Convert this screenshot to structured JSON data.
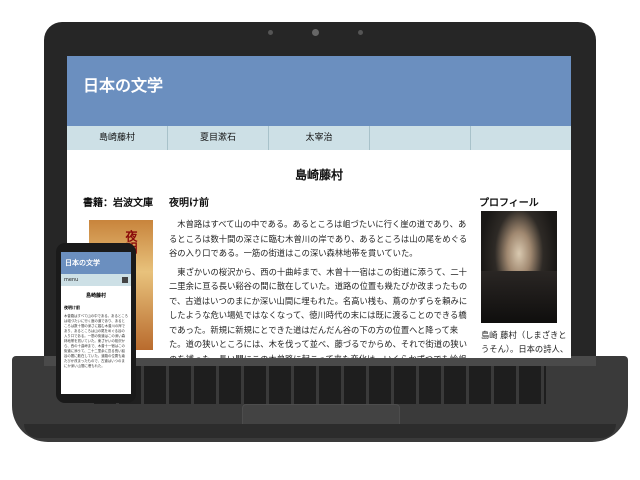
{
  "site": {
    "logo": "日本の文学"
  },
  "nav": [
    {
      "label": "島崎藤村"
    },
    {
      "label": "夏目漱石"
    },
    {
      "label": "太宰治"
    },
    {
      "label": ""
    },
    {
      "label": ""
    }
  ],
  "page_title": "島崎藤村",
  "left_column": {
    "heading": "書籍：岩波文庫",
    "book_cover_text": "夜明"
  },
  "main": {
    "heading": "夜明け前",
    "paragraphs": [
      "木曾路はすべて山の中である。あるところは岨づたいに行く崖の道であり、あるところは数十間の深さに臨む木曾川の岸であり、あるところは山の尾をめぐる谷の入り口である。一筋の街道はこの深い森林地帯を貫いていた。",
      "東ざかいの桜沢から、西の十曲峠まで、木曾十一宿はこの街道に添うて、二十二里余に亘る長い谿谷の間に散在していた。道路の位置も幾たびか改まったもので、古道はいつのまにか深い山間に埋もれた。名高い桟も、蔦のかずらを頼みにしたような危い場処ではなくなって、徳川時代の末には既に渡ることのできる橋であった。新規に新規にとできた道はだんだん谷の下の方の位置へと降って来た。道の狭いところには、木を伐って並べ、藤づるでからめ、それで街道の狭いのを補った。長い間にこの木曾路に起こって来た変化は、いくらかずつでも嶮岨な山坂の多いところを歩きよくした。そのかわり、大雨ごとにやって来る河水の氾濫が旅行を困難にする。そのたびに旅人は最寄り最寄りの宿場に逗留して、道路の開通を待つこともめずらしくない。"
    ]
  },
  "profile": {
    "heading": "プロフィール",
    "caption": "島崎 藤村（しまざきとうそん）。日本の詩人、小説家。"
  },
  "phone": {
    "logo": "日本の文学",
    "menu_label": "menu",
    "page_title": "島崎藤村",
    "subheading": "夜明け前",
    "text": "木曾路はすべて山の中である。あるところは岨づたいに行く崖の道であり、あるところは数十間の深さに臨む木曾川の岸であり、あるところは山の尾をめぐる谷の入り口である。一筋の街道はこの深い森林地帯を貫いていた。東ざかいの桜沢から、西の十曲峠まで、木曾十一宿はこの街道に添うて、二十二里余に亘る長い谿谷の間に散在していた。道路の位置も幾たびか改まったもので、古道はいつのまにか深い山間に埋もれた。"
  },
  "colors": {
    "header": "#6b8fbf",
    "nav": "#cde0e6",
    "device_frame": "#262626"
  }
}
